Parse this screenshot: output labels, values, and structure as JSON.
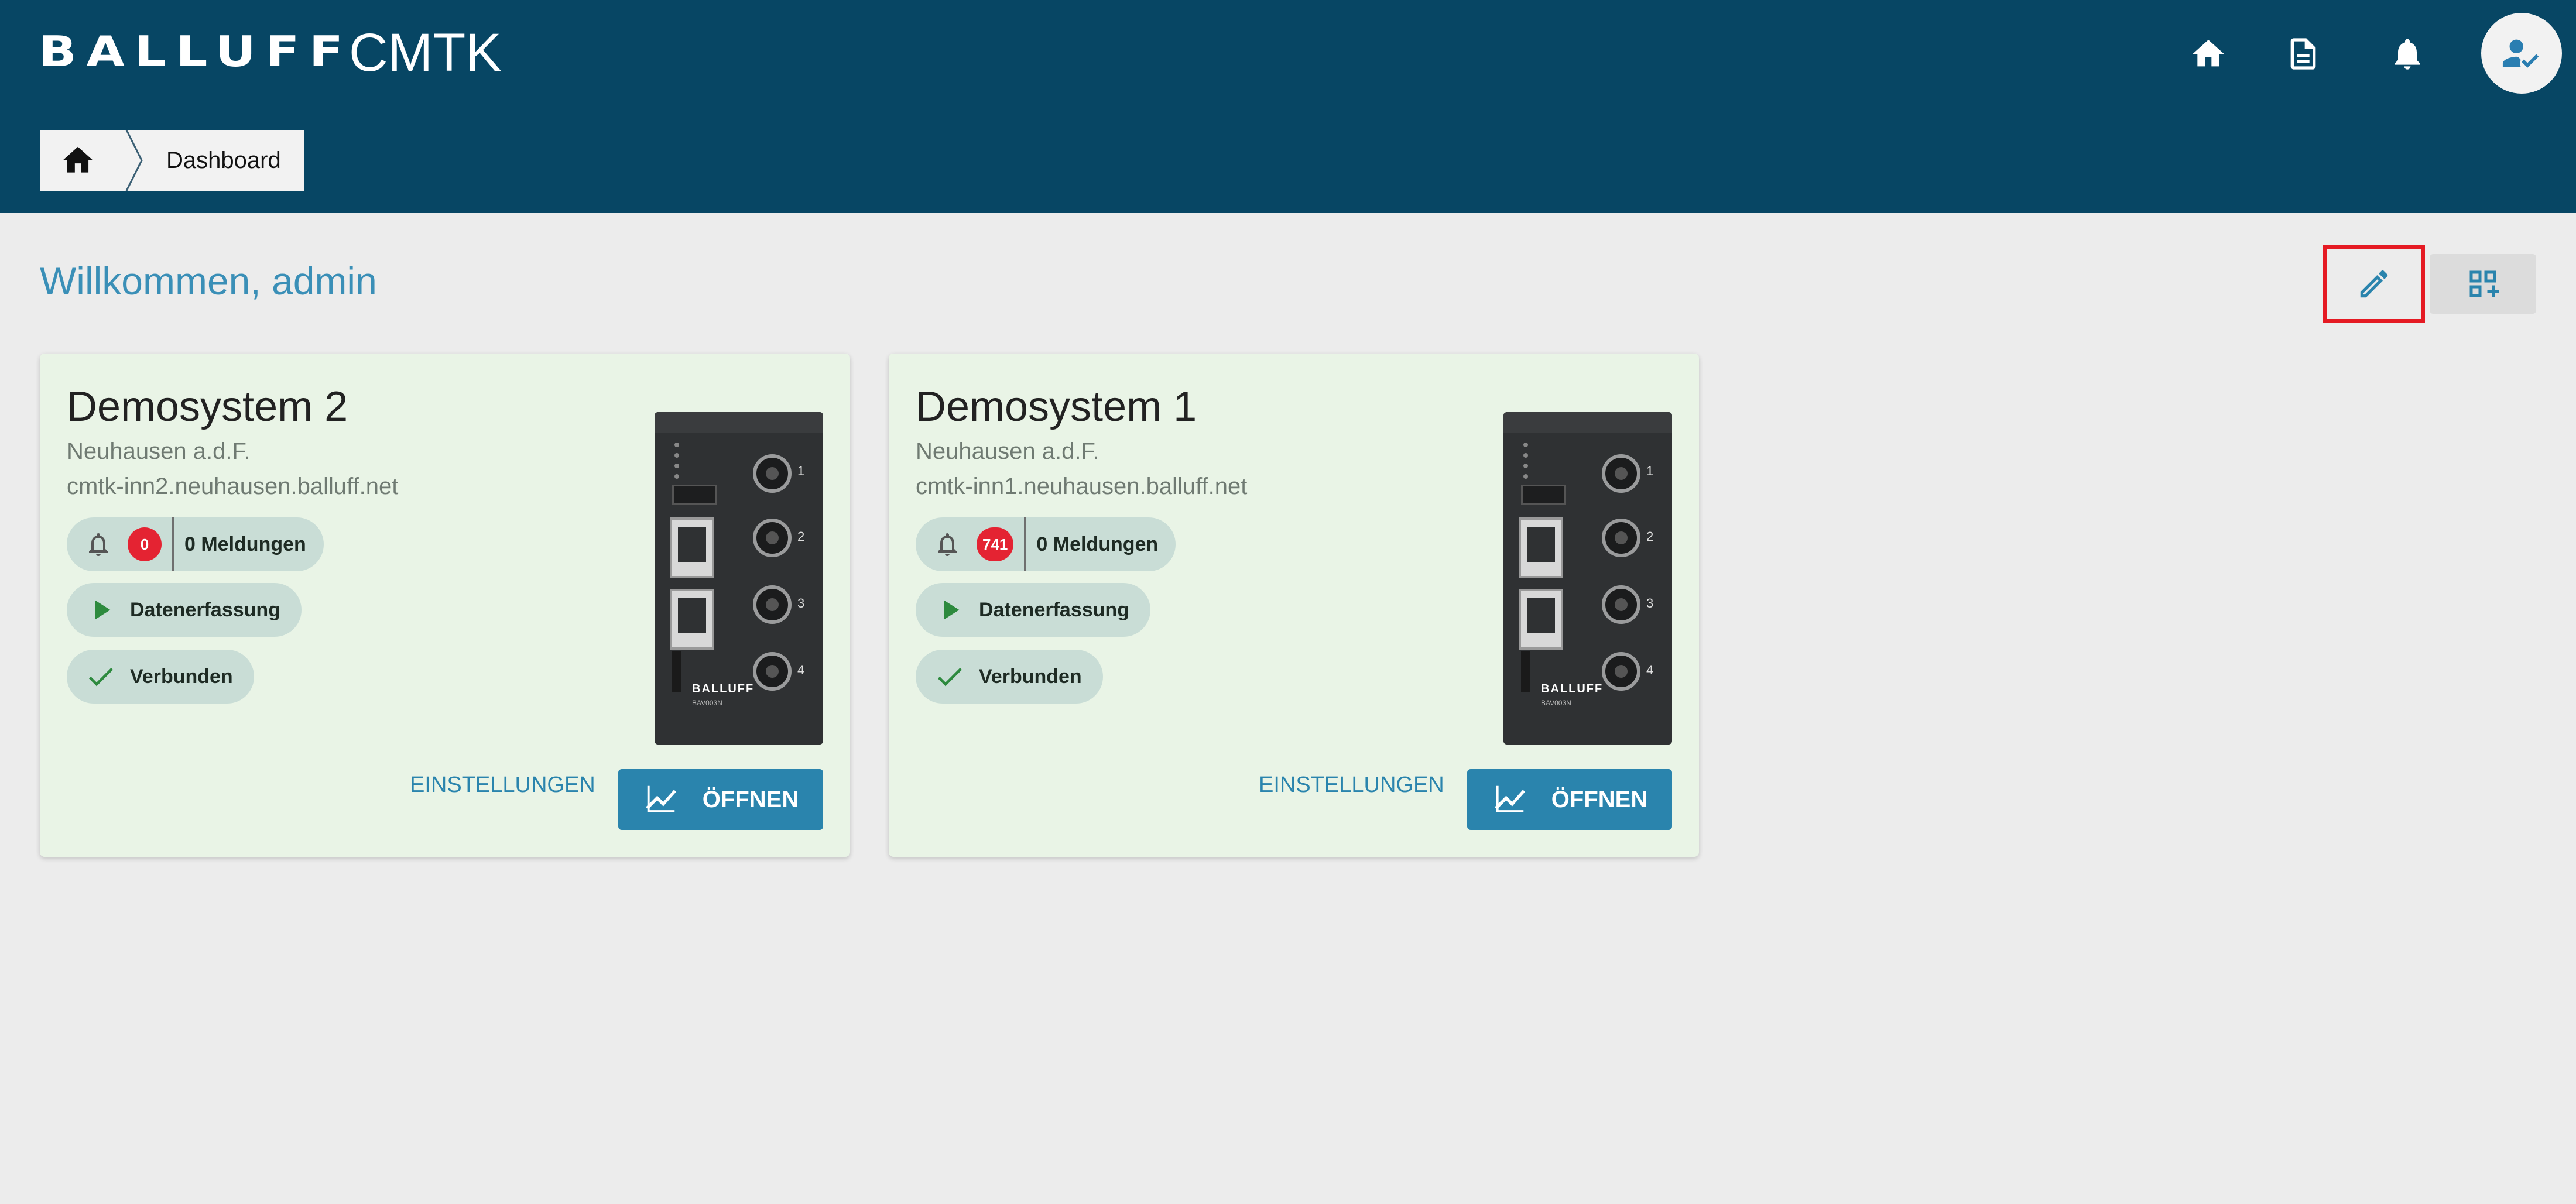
{
  "header": {
    "logo_text": "BALLUFF",
    "app_title": "CMTK",
    "icons": [
      "home-icon",
      "document-icon",
      "bell-icon",
      "user-check-icon"
    ]
  },
  "breadcrumb": {
    "home_icon": "home-icon",
    "current": "Dashboard"
  },
  "main": {
    "welcome": "Willkommen, admin",
    "toolbar": {
      "edit_icon": "pencil-icon",
      "add_widget_icon": "dashboard-add-icon"
    }
  },
  "cards": [
    {
      "title": "Demosystem 2",
      "location": "Neuhausen a.d.F.",
      "host": "cmtk-inn2.neuhausen.balluff.net",
      "message_count": "0",
      "messages_label": "0 Meldungen",
      "data_label": "Datenerfassung",
      "status_label": "Verbunden",
      "settings_label": "EINSTELLUNGEN",
      "open_label": "ÖFFNEN"
    },
    {
      "title": "Demosystem 1",
      "location": "Neuhausen a.d.F.",
      "host": "cmtk-inn1.neuhausen.balluff.net",
      "message_count": "741",
      "messages_label": "0 Meldungen",
      "data_label": "Datenerfassung",
      "status_label": "Verbunden",
      "settings_label": "EINSTELLUNGEN",
      "open_label": "ÖFFNEN"
    }
  ],
  "device_image": {
    "brand": "BALLUFF",
    "model": "BAV003N",
    "port_numbers": [
      "1",
      "2",
      "3",
      "4"
    ]
  },
  "colors": {
    "header_bg": "#074664",
    "accent": "#2a84ad",
    "card_bg": "#e9f4e6",
    "badge_red": "#e42332",
    "highlight_border": "#e51a23"
  }
}
